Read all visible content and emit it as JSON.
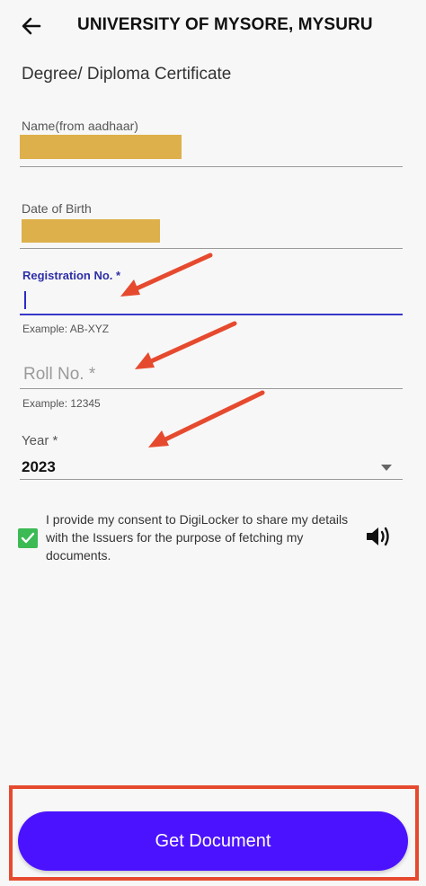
{
  "header": {
    "title": "UNIVERSITY OF MYSORE, MYSURU"
  },
  "document": {
    "title": "Degree/ Diploma Certificate"
  },
  "fields": {
    "name": {
      "label": "Name(from aadhaar)"
    },
    "dob": {
      "label": "Date of Birth"
    },
    "registration": {
      "label": "Registration No. *",
      "value": "",
      "helper": "Example: AB-XYZ"
    },
    "roll": {
      "placeholder": "Roll No. *",
      "value": "",
      "helper": "Example: 12345"
    },
    "year": {
      "label": "Year *",
      "value": "2023"
    }
  },
  "consent": {
    "checked": true,
    "text": "I provide my consent to DigiLocker to share my details with the Issuers for the purpose of fetching my documents."
  },
  "actions": {
    "primary_label": "Get Document"
  },
  "colors": {
    "accent": "#4b12ff",
    "focus": "#3838c8",
    "checkbox": "#3cba54",
    "annotation": "#e64a2e",
    "redaction": "#ddb04b"
  }
}
